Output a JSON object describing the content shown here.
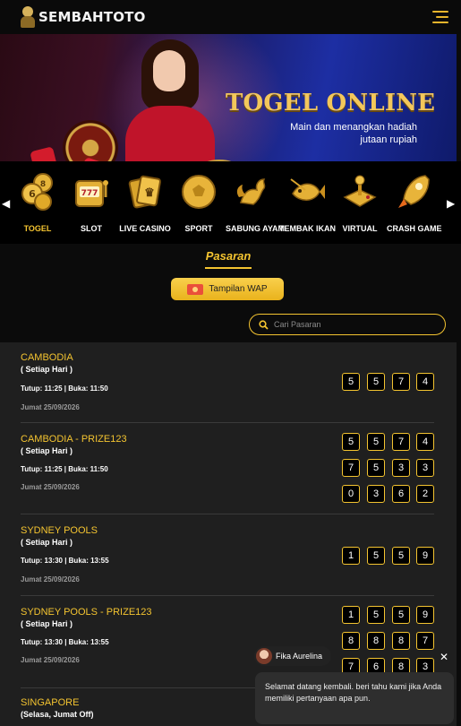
{
  "brand": {
    "name": "SEMBAHTOTO"
  },
  "banner": {
    "title": "TOGEL ONLINE",
    "subtitle_line1": "Main dan menangkan hadiah",
    "subtitle_line2": "jutaan rupiah"
  },
  "categories": [
    {
      "label": "TOGEL",
      "icon": "lottery-balls-icon",
      "active": true
    },
    {
      "label": "SLOT",
      "icon": "slot-machine-icon",
      "active": false
    },
    {
      "label": "LIVE CASINO",
      "icon": "playing-cards-icon",
      "active": false
    },
    {
      "label": "SPORT",
      "icon": "soccer-ball-icon",
      "active": false
    },
    {
      "label": "SABUNG AYAM",
      "icon": "rooster-icon",
      "active": false
    },
    {
      "label": "TEMBAK IKAN",
      "icon": "fish-icon",
      "active": false
    },
    {
      "label": "VIRTUAL",
      "icon": "joystick-icon",
      "active": false
    },
    {
      "label": "CRASH GAME",
      "icon": "rocket-icon",
      "active": false
    }
  ],
  "pasaran": {
    "title": "Pasaran",
    "wap_button": "Tampilan WAP",
    "search_placeholder": "Cari Pasaran"
  },
  "markets": [
    {
      "name": "CAMBODIA",
      "schedule": "( Setiap Hari )",
      "times": "Tutup: 11:25 | Buka: 11:50",
      "date": "Jumat 25/09/2026",
      "results": [
        [
          "5",
          "5",
          "7",
          "4"
        ]
      ]
    },
    {
      "name": "CAMBODIA - PRIZE123",
      "schedule": "( Setiap Hari )",
      "times": "Tutup: 11:25 | Buka: 11:50",
      "date": "Jumat 25/09/2026",
      "results": [
        [
          "5",
          "5",
          "7",
          "4"
        ],
        [
          "7",
          "5",
          "3",
          "3"
        ],
        [
          "0",
          "3",
          "6",
          "2"
        ]
      ]
    },
    {
      "name": "SYDNEY POOLS",
      "schedule": "( Setiap Hari )",
      "times": "Tutup: 13:30 | Buka: 13:55",
      "date": "Jumat 25/09/2026",
      "results": [
        [
          "1",
          "5",
          "5",
          "9"
        ]
      ]
    },
    {
      "name": "SYDNEY POOLS - PRIZE123",
      "schedule": "( Setiap Hari )",
      "times": "Tutup: 13:30 | Buka: 13:55",
      "date": "Jumat 25/09/2026",
      "results": [
        [
          "1",
          "5",
          "5",
          "9"
        ],
        [
          "8",
          "8",
          "8",
          "7"
        ],
        [
          "7",
          "6",
          "8",
          "3"
        ]
      ]
    },
    {
      "name": "SINGAPORE",
      "schedule": "(Selasa, Jumat Off)",
      "times": "",
      "date": "",
      "results": []
    }
  ],
  "chat": {
    "agent_name": "Fika Aurelina",
    "close": "✕",
    "message": "Selamat datang kembali. beri tahu kami jika Anda memiliki pertanyaan apa pun."
  },
  "colors": {
    "accent": "#f4c430",
    "background": "#0b0b0b",
    "list_bg": "#1f1f1f"
  }
}
